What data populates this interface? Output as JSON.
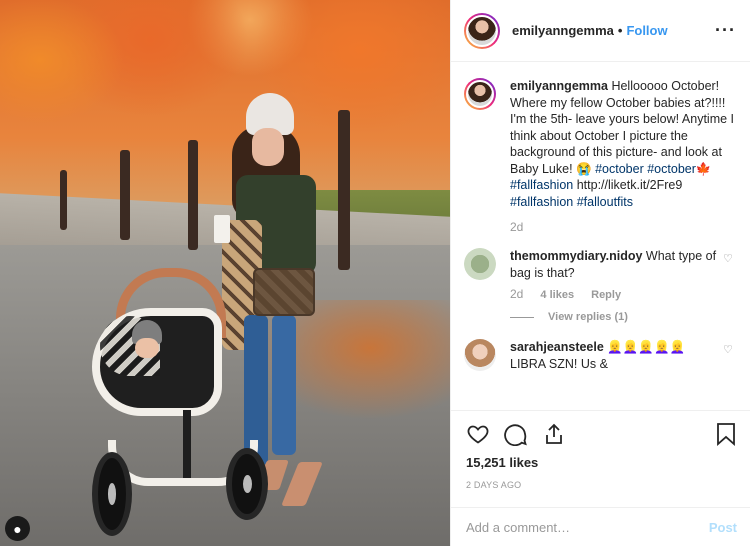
{
  "photo": {
    "alt_icons": [
      "user-tag-icon"
    ]
  },
  "header": {
    "username": "emilyanngemma",
    "dot": "•",
    "follow_label": "Follow",
    "more_label": "···"
  },
  "caption": {
    "username": "emilyanngemma",
    "text": "Hellooooo October! Where my fellow October babies at?!!!! I'm the 5th- leave yours below! Anytime I think about October I picture the background of this picture- and look at Baby Luke!",
    "emoji1": "😭",
    "tag1": "#october",
    "tag2": "#october",
    "emoji2": "🍁",
    "tag3": "#fallfashion",
    "link": "http://liketk.it/2Fre9",
    "tag4": "#fallfashion",
    "tag5": "#falloutfits",
    "time": "2d"
  },
  "comments": [
    {
      "username": "themommydiary.nidoy",
      "text": "What type of bag is that?",
      "time": "2d",
      "likes": "4 likes",
      "reply_label": "Reply",
      "view_replies": "View replies (1)"
    },
    {
      "username": "sarahjeansteele",
      "text": "👱‍♀️👱‍♀️👱‍♀️👱‍♀️👱‍♀️ LIBRA SZN! Us &"
    }
  ],
  "actions": {
    "icons": [
      "heart-icon",
      "comment-icon",
      "share-icon",
      "bookmark-icon"
    ],
    "likes": "15,251 likes",
    "time_ago": "2 DAYS AGO"
  },
  "add_comment": {
    "placeholder": "Add a comment…",
    "post_label": "Post"
  },
  "colors": {
    "link_blue": "#3897f0",
    "post_disabled": "#b2dffc",
    "hashtag": "#003569"
  }
}
